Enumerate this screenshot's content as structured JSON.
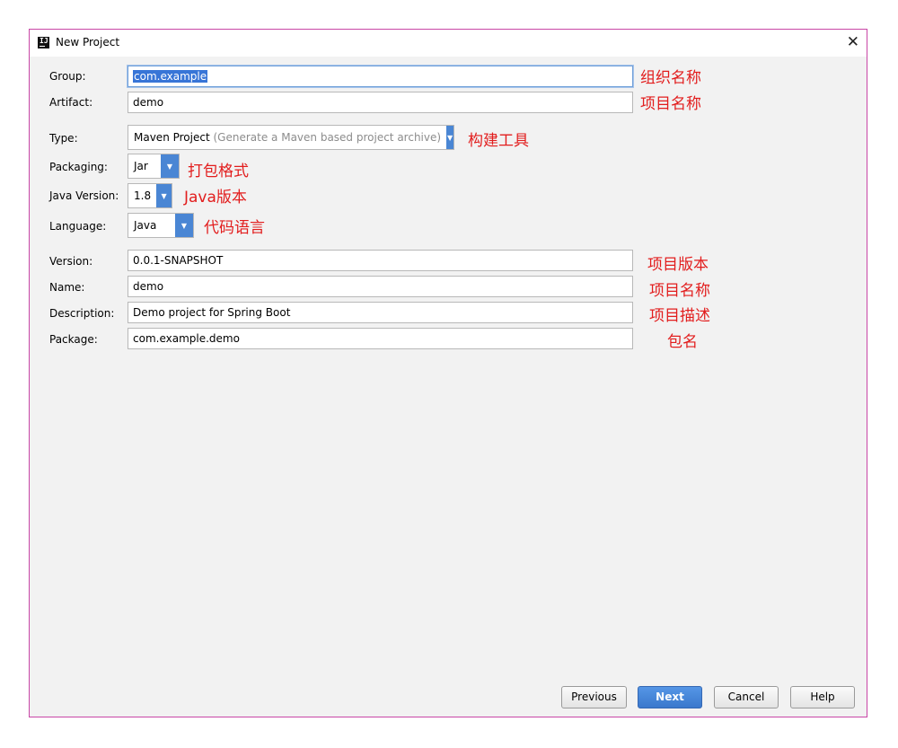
{
  "window": {
    "title": "New Project",
    "app_icon": "IJ",
    "close_glyph": "✕"
  },
  "fields": {
    "group": {
      "label": "Group:",
      "value": "com.example",
      "note": "组织名称"
    },
    "artifact": {
      "label": "Artifact:",
      "value": "demo",
      "note": "项目名称"
    },
    "type": {
      "label": "Type:",
      "value": "Maven Project",
      "hint": "(Generate a Maven based project archive)",
      "note": "构建工具"
    },
    "packaging": {
      "label": "Packaging:",
      "value": "Jar",
      "note": "打包格式"
    },
    "java_version": {
      "label": "Java Version:",
      "value": "1.8",
      "note": "Java版本"
    },
    "language": {
      "label": "Language:",
      "value": "Java",
      "note": "代码语言"
    },
    "version": {
      "label": "Version:",
      "value": "0.0.1-SNAPSHOT",
      "note": "项目版本"
    },
    "name": {
      "label": "Name:",
      "value": "demo",
      "note": "项目名称"
    },
    "description": {
      "label": "Description:",
      "value": "Demo project for Spring Boot",
      "note": "项目描述"
    },
    "package": {
      "label": "Package:",
      "value": "com.example.demo",
      "note": "包名"
    }
  },
  "buttons": {
    "previous": "Previous",
    "next": "Next",
    "cancel": "Cancel",
    "help": "Help"
  },
  "icons": {
    "dropdown": "chevron-down-icon",
    "close": "close-icon",
    "app": "intellij-logo-icon"
  },
  "colors": {
    "accent": "#4a86d4",
    "note": "#e21d1d",
    "border": "#c846a6"
  }
}
